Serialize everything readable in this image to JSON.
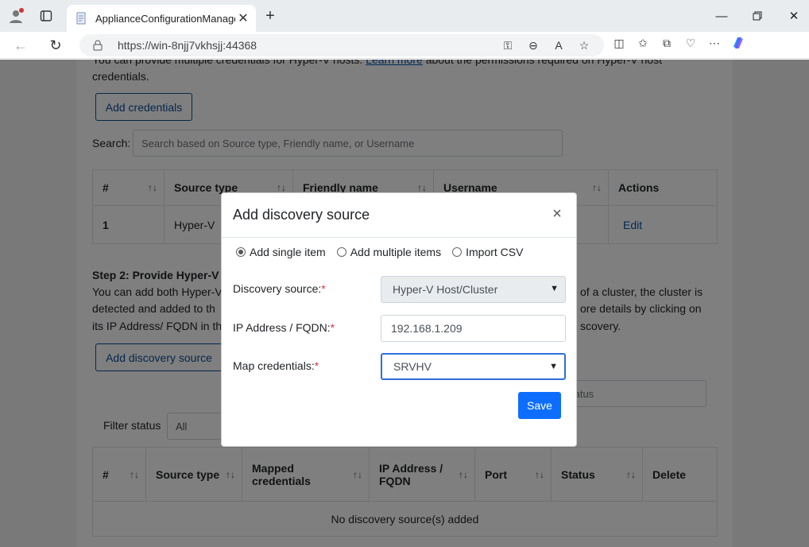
{
  "browser": {
    "tab_title": "ApplianceConfigurationManager",
    "url": "https://win-8njj7vkhsjj:44368"
  },
  "page": {
    "intro_line1": "You can provide multiple credentials for Hyper-V hosts.",
    "learn_more": "Learn more",
    "intro_line1_after": "about the permissions required on Hyper-V host",
    "intro_line2": "credentials.",
    "add_credentials": "Add credentials",
    "search_label": "Search:",
    "search_placeholder": "Search based on Source type, Friendly name, or Username",
    "cred_table": {
      "headers": [
        "#",
        "Source type",
        "Friendly name",
        "Username",
        "Actions"
      ],
      "rows": [
        {
          "num": "1",
          "source_type": "Hyper-V",
          "action": "Edit"
        }
      ]
    },
    "step2_title": "Step 2: Provide Hyper-V",
    "step2_line1_left": "You can add both Hyper-V",
    "step2_line1_right": "of a cluster, the cluster is",
    "step2_line2_left": "detected and added to th",
    "step2_line2_right": "ore details by clicking on",
    "step2_line3_left": "its IP Address/ FQDN in th",
    "step2_line3_right": "scovery.",
    "add_discovery_source": "Add discovery source",
    "status_placeholder": "tatus",
    "filter_label": "Filter status",
    "filter_value": "All",
    "disc_table": {
      "headers": [
        "#",
        "Source type",
        "Mapped credentials",
        "IP Address / FQDN",
        "Port",
        "Status",
        "Delete"
      ],
      "empty": "No discovery source(s) added"
    }
  },
  "modal": {
    "title": "Add discovery source",
    "close": "×",
    "radios": [
      {
        "label": "Add single item",
        "selected": true
      },
      {
        "label": "Add multiple items",
        "selected": false
      },
      {
        "label": "Import CSV",
        "selected": false
      }
    ],
    "discovery_source_label": "Discovery source:",
    "discovery_source_value": "Hyper-V Host/Cluster",
    "ip_label": "IP Address / FQDN:",
    "ip_value": "192.168.1.209",
    "map_label": "Map credentials:",
    "map_value": "SRVHV",
    "required_mark": "*",
    "save": "Save"
  }
}
